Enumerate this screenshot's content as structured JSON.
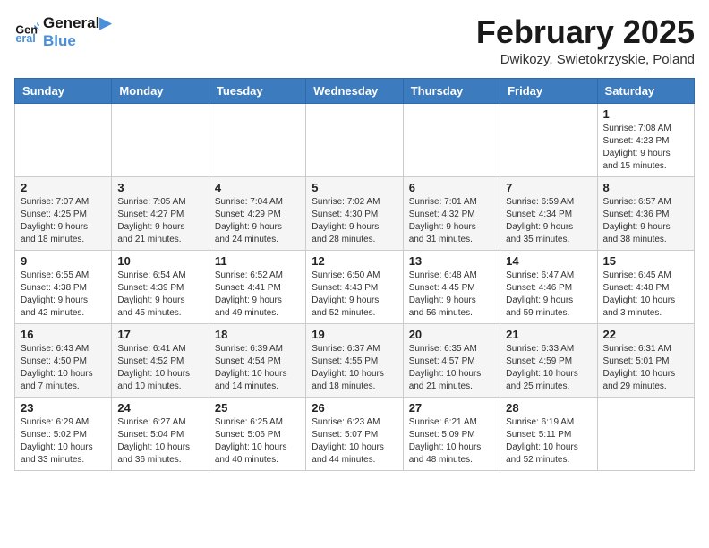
{
  "header": {
    "logo_line1": "General",
    "logo_line2": "Blue",
    "month_title": "February 2025",
    "location": "Dwikozy, Swietokrzyskie, Poland"
  },
  "weekdays": [
    "Sunday",
    "Monday",
    "Tuesday",
    "Wednesday",
    "Thursday",
    "Friday",
    "Saturday"
  ],
  "weeks": [
    [
      {
        "day": "",
        "info": ""
      },
      {
        "day": "",
        "info": ""
      },
      {
        "day": "",
        "info": ""
      },
      {
        "day": "",
        "info": ""
      },
      {
        "day": "",
        "info": ""
      },
      {
        "day": "",
        "info": ""
      },
      {
        "day": "1",
        "info": "Sunrise: 7:08 AM\nSunset: 4:23 PM\nDaylight: 9 hours\nand 15 minutes."
      }
    ],
    [
      {
        "day": "2",
        "info": "Sunrise: 7:07 AM\nSunset: 4:25 PM\nDaylight: 9 hours\nand 18 minutes."
      },
      {
        "day": "3",
        "info": "Sunrise: 7:05 AM\nSunset: 4:27 PM\nDaylight: 9 hours\nand 21 minutes."
      },
      {
        "day": "4",
        "info": "Sunrise: 7:04 AM\nSunset: 4:29 PM\nDaylight: 9 hours\nand 24 minutes."
      },
      {
        "day": "5",
        "info": "Sunrise: 7:02 AM\nSunset: 4:30 PM\nDaylight: 9 hours\nand 28 minutes."
      },
      {
        "day": "6",
        "info": "Sunrise: 7:01 AM\nSunset: 4:32 PM\nDaylight: 9 hours\nand 31 minutes."
      },
      {
        "day": "7",
        "info": "Sunrise: 6:59 AM\nSunset: 4:34 PM\nDaylight: 9 hours\nand 35 minutes."
      },
      {
        "day": "8",
        "info": "Sunrise: 6:57 AM\nSunset: 4:36 PM\nDaylight: 9 hours\nand 38 minutes."
      }
    ],
    [
      {
        "day": "9",
        "info": "Sunrise: 6:55 AM\nSunset: 4:38 PM\nDaylight: 9 hours\nand 42 minutes."
      },
      {
        "day": "10",
        "info": "Sunrise: 6:54 AM\nSunset: 4:39 PM\nDaylight: 9 hours\nand 45 minutes."
      },
      {
        "day": "11",
        "info": "Sunrise: 6:52 AM\nSunset: 4:41 PM\nDaylight: 9 hours\nand 49 minutes."
      },
      {
        "day": "12",
        "info": "Sunrise: 6:50 AM\nSunset: 4:43 PM\nDaylight: 9 hours\nand 52 minutes."
      },
      {
        "day": "13",
        "info": "Sunrise: 6:48 AM\nSunset: 4:45 PM\nDaylight: 9 hours\nand 56 minutes."
      },
      {
        "day": "14",
        "info": "Sunrise: 6:47 AM\nSunset: 4:46 PM\nDaylight: 9 hours\nand 59 minutes."
      },
      {
        "day": "15",
        "info": "Sunrise: 6:45 AM\nSunset: 4:48 PM\nDaylight: 10 hours\nand 3 minutes."
      }
    ],
    [
      {
        "day": "16",
        "info": "Sunrise: 6:43 AM\nSunset: 4:50 PM\nDaylight: 10 hours\nand 7 minutes."
      },
      {
        "day": "17",
        "info": "Sunrise: 6:41 AM\nSunset: 4:52 PM\nDaylight: 10 hours\nand 10 minutes."
      },
      {
        "day": "18",
        "info": "Sunrise: 6:39 AM\nSunset: 4:54 PM\nDaylight: 10 hours\nand 14 minutes."
      },
      {
        "day": "19",
        "info": "Sunrise: 6:37 AM\nSunset: 4:55 PM\nDaylight: 10 hours\nand 18 minutes."
      },
      {
        "day": "20",
        "info": "Sunrise: 6:35 AM\nSunset: 4:57 PM\nDaylight: 10 hours\nand 21 minutes."
      },
      {
        "day": "21",
        "info": "Sunrise: 6:33 AM\nSunset: 4:59 PM\nDaylight: 10 hours\nand 25 minutes."
      },
      {
        "day": "22",
        "info": "Sunrise: 6:31 AM\nSunset: 5:01 PM\nDaylight: 10 hours\nand 29 minutes."
      }
    ],
    [
      {
        "day": "23",
        "info": "Sunrise: 6:29 AM\nSunset: 5:02 PM\nDaylight: 10 hours\nand 33 minutes."
      },
      {
        "day": "24",
        "info": "Sunrise: 6:27 AM\nSunset: 5:04 PM\nDaylight: 10 hours\nand 36 minutes."
      },
      {
        "day": "25",
        "info": "Sunrise: 6:25 AM\nSunset: 5:06 PM\nDaylight: 10 hours\nand 40 minutes."
      },
      {
        "day": "26",
        "info": "Sunrise: 6:23 AM\nSunset: 5:07 PM\nDaylight: 10 hours\nand 44 minutes."
      },
      {
        "day": "27",
        "info": "Sunrise: 6:21 AM\nSunset: 5:09 PM\nDaylight: 10 hours\nand 48 minutes."
      },
      {
        "day": "28",
        "info": "Sunrise: 6:19 AM\nSunset: 5:11 PM\nDaylight: 10 hours\nand 52 minutes."
      },
      {
        "day": "",
        "info": ""
      }
    ]
  ]
}
